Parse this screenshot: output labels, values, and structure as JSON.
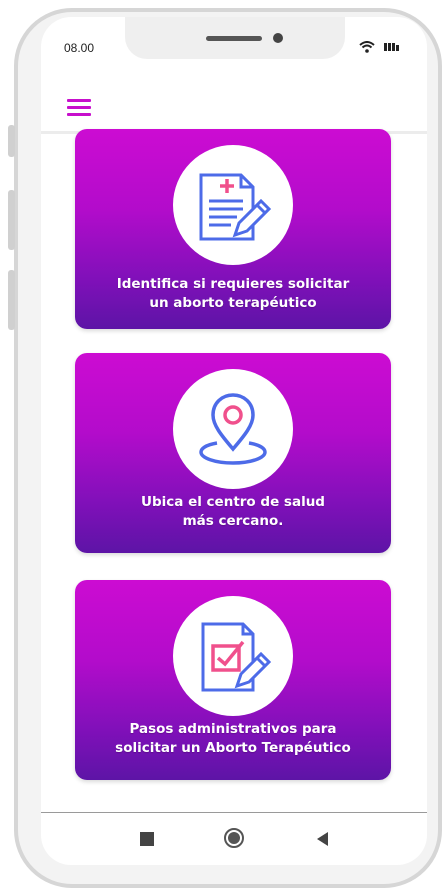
{
  "status_bar": {
    "time": "08.00",
    "icons": [
      "wifi-icon",
      "battery-icon"
    ]
  },
  "header": {
    "menu_icon": "hamburger-menu-icon",
    "accent_color": "#c70fcc"
  },
  "cards": [
    {
      "icon": "medical-form-pencil-icon",
      "line1": "Identifica si requieres solicitar",
      "line2": "un aborto terapéutico"
    },
    {
      "icon": "location-pin-icon",
      "line1": "Ubica el centro de salud",
      "line2": "más cercano."
    },
    {
      "icon": "checklist-pencil-icon",
      "line1": "Pasos administrativos para",
      "line2": "solicitar un Aborto Terapéutico"
    }
  ],
  "colors": {
    "card_gradient_top": "#cc0cd2",
    "card_gradient_bottom": "#5d14a6",
    "icon_blue": "#4d6be8",
    "icon_pink": "#f0508c"
  },
  "nav_bar": {
    "icons": [
      "recent-apps-icon",
      "home-icon",
      "back-icon"
    ]
  }
}
